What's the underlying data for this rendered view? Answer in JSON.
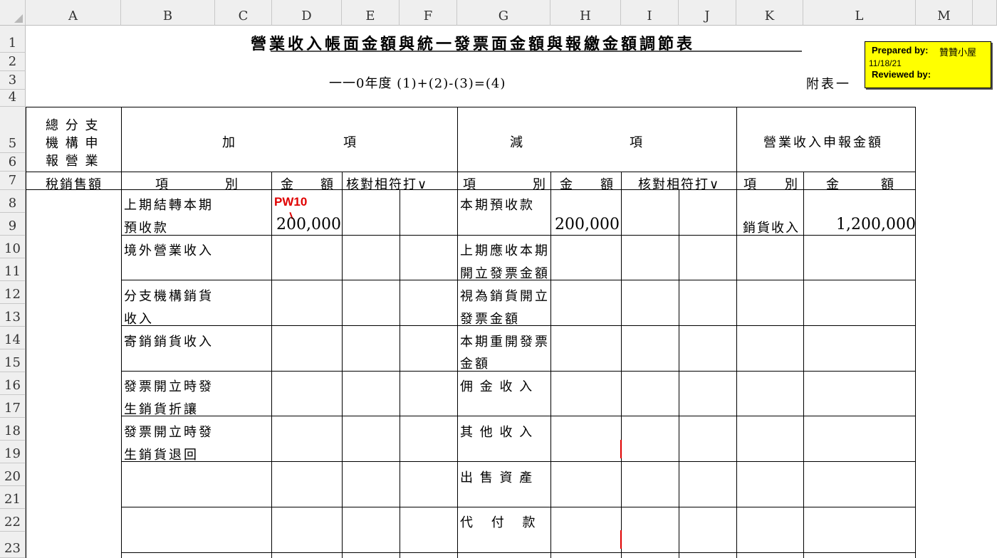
{
  "columns": [
    "A",
    "B",
    "C",
    "D",
    "E",
    "F",
    "G",
    "H",
    "I",
    "J",
    "K",
    "L",
    "M"
  ],
  "rows": [
    "1",
    "2",
    "3",
    "4",
    "5",
    "6",
    "7",
    "8",
    "9",
    "10",
    "11",
    "12",
    "13",
    "14",
    "15",
    "16",
    "17",
    "18",
    "19",
    "20",
    "21",
    "22",
    "23"
  ],
  "sheet": {
    "title": "營業收入帳面金額與統一發票面金額與報繳金額調節表",
    "subtitle": "一一0年度 (1)+(2)-(3)=(4)",
    "appendix": "附表一"
  },
  "header": {
    "branch_lines": [
      "總 分 支",
      "機 構 申",
      "報 營 業"
    ],
    "branch_sales": "稅銷售額",
    "add_left": "加",
    "add_right": "項",
    "sub_left": "減",
    "sub_right": "項",
    "revenue": "營業收入申報金額"
  },
  "subheader": {
    "item_a": "項",
    "item_b": "別",
    "amount_a": "金",
    "amount_b": "額",
    "check": "核對相符打∨"
  },
  "add_items": [
    [
      "上期結轉本期",
      "預收款"
    ],
    [
      "境外營業收入",
      ""
    ],
    [
      "分支機構銷貨",
      "收入"
    ],
    [
      "寄銷銷貨收入",
      ""
    ],
    [
      "發票開立時發",
      "生銷貨折讓"
    ],
    [
      "發票開立時發",
      "生銷貨退回"
    ]
  ],
  "sub_items": [
    [
      "本期預收款",
      ""
    ],
    [
      "上期應收本期",
      "開立發票金額"
    ],
    [
      "視為銷貨開立",
      "發票金額"
    ],
    [
      "本期重開發票",
      "金額"
    ],
    [
      "佣 金 收 入",
      ""
    ],
    [
      "其 他 收 入",
      ""
    ],
    [
      "出 售 資 產",
      ""
    ],
    [
      "代 付 款",
      ""
    ]
  ],
  "values": {
    "add_amount": "200,000",
    "sub_amount": "200,000",
    "revenue_item": "銷貨收入",
    "revenue_amount": "1,200,000",
    "tickmark": "PW10"
  },
  "note": {
    "prepared_label": "Prepared by:",
    "prepared_name": "贊贊小屋",
    "date": "11/18/21",
    "reviewed_label": "Reviewed by:"
  }
}
